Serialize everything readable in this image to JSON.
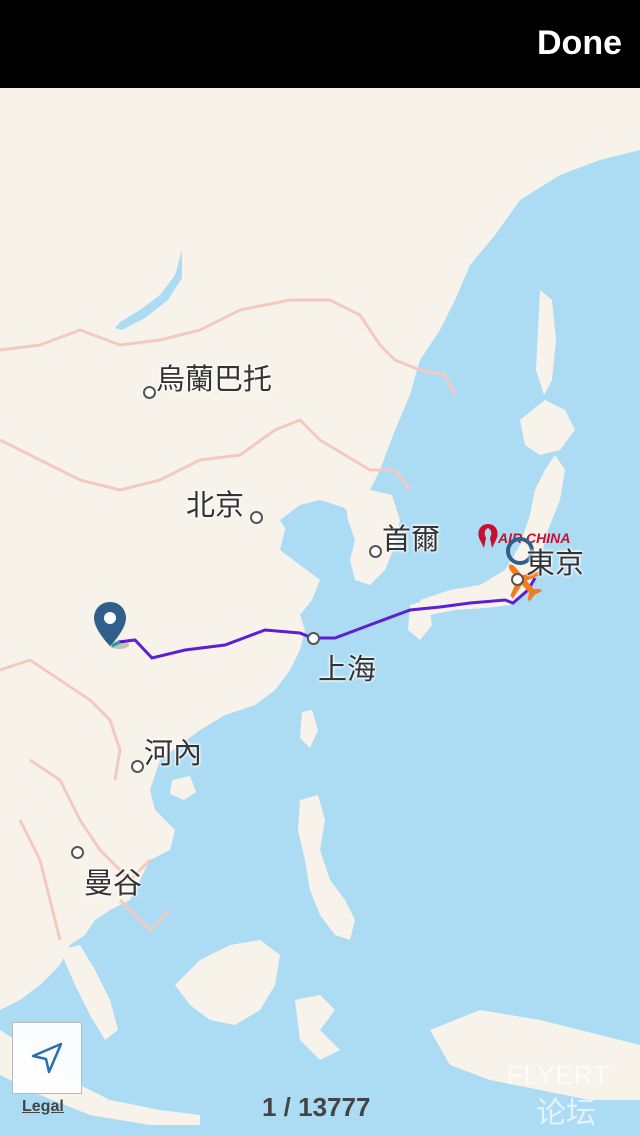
{
  "header": {
    "done_label": "Done"
  },
  "map": {
    "cities": [
      {
        "id": "ulaanbaatar",
        "name": "烏蘭巴托"
      },
      {
        "id": "beijing",
        "name": "北京"
      },
      {
        "id": "seoul",
        "name": "首爾"
      },
      {
        "id": "tokyo",
        "name": "東京"
      },
      {
        "id": "shanghai",
        "name": "上海"
      },
      {
        "id": "hanoi",
        "name": "河內"
      },
      {
        "id": "bangkok",
        "name": "曼谷"
      }
    ],
    "airline_label": "AIR CHINA",
    "watermark": "FLYERT",
    "watermark_sub": "论坛"
  },
  "footer": {
    "legal_label": "Legal",
    "pager_text": "1 / 13777"
  },
  "colors": {
    "ocean": "#acdcf4",
    "land": "#f8f3ea",
    "border": "#f4c9c2",
    "route": "#5b1fd6",
    "plane": "#f47a20",
    "pin": "#2f5f8a",
    "airline": "#c8102e"
  }
}
